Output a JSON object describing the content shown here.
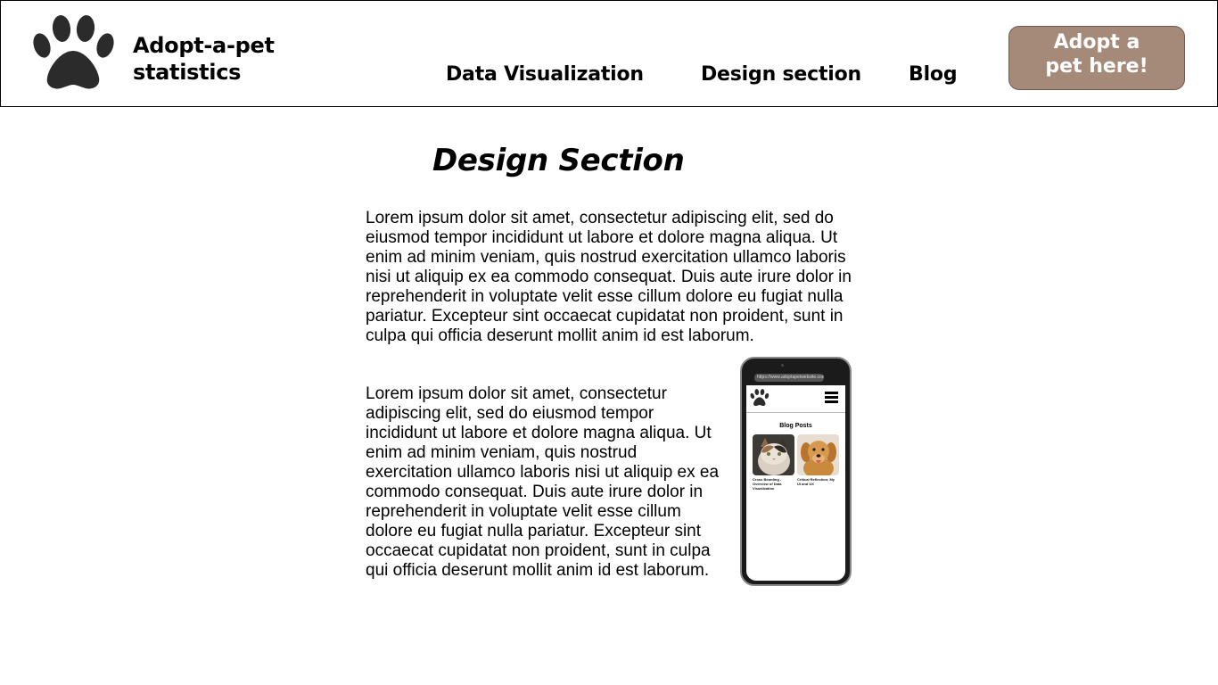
{
  "header": {
    "brand_line1": "Adopt-a-pet",
    "brand_line2": "statistics",
    "logo_icon": "paw-icon"
  },
  "nav": {
    "items": [
      {
        "label": "Data Visualization"
      },
      {
        "label": "Design section"
      },
      {
        "label": "Blog"
      }
    ]
  },
  "cta": {
    "line1": "Adopt a",
    "line2": "pet here!",
    "bg_color": "#a58a7a"
  },
  "main": {
    "title": "Design Section",
    "paragraphs": [
      "Lorem ipsum dolor sit amet, consectetur adipiscing elit, sed do eiusmod tempor incididunt ut labore et dolore magna aliqua. Ut enim ad minim veniam, quis nostrud exercitation ullamco laboris nisi ut aliquip ex ea commodo consequat. Duis aute irure dolor in reprehenderit in voluptate velit esse cillum dolore eu fugiat nulla pariatur. Excepteur sint occaecat cupidatat non proident, sunt in culpa qui officia deserunt mollit anim id est laborum.",
      "Lorem ipsum dolor sit amet, consectetur adipiscing elit, sed do eiusmod tempor incididunt ut labore et dolore magna aliqua. Ut enim ad minim veniam, quis nostrud exercitation ullamco laboris nisi ut aliquip ex ea commodo consequat. Duis aute irure dolor in reprehenderit in voluptate velit esse cillum dolore eu fugiat nulla pariatur. Excepteur sint occaecat cupidatat non proident, sunt in culpa qui officia deserunt mollit anim id est laborum."
    ]
  },
  "phone_mockup": {
    "url": "https://www.adoptapetwebsite.com",
    "heading": "Blog Posts",
    "menu_icon": "hamburger-menu-icon",
    "cards": [
      {
        "caption": "Cross Bearding - Overview of Data Visualization",
        "image": "cat-photo"
      },
      {
        "caption": "Critical Reflection: My UI and UX",
        "image": "dog-photo"
      }
    ]
  }
}
